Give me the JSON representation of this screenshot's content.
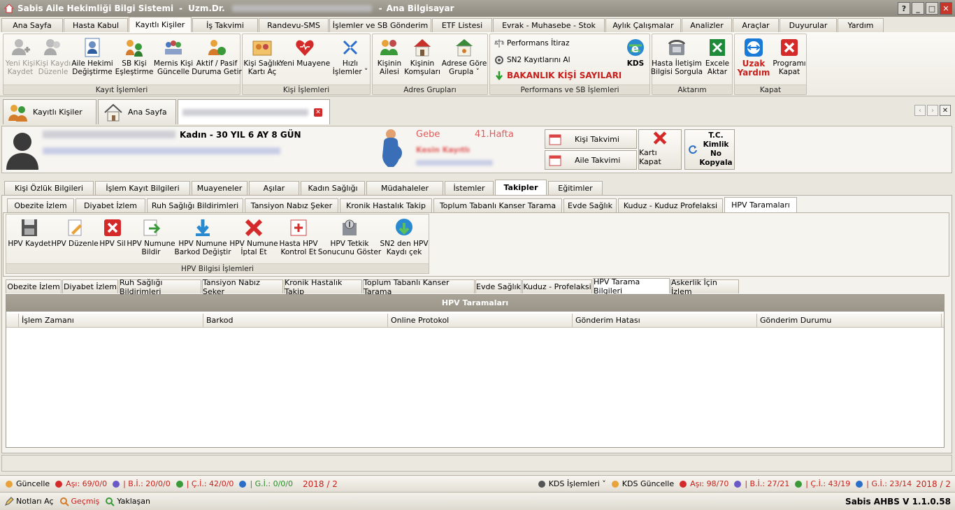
{
  "window": {
    "title": "Sabis Aile Hekimliği Bilgi Sistemi",
    "user_label": "Uzm.Dr.",
    "computer_label": "Ana Bilgisayar",
    "buttons": [
      "?",
      "_",
      "□",
      "✕"
    ]
  },
  "menu_tabs": [
    {
      "label": "Ana Sayfa",
      "w": 88
    },
    {
      "label": "Hasta Kabul",
      "w": 92
    },
    {
      "label": "Kayıtlı Kişiler",
      "w": 90,
      "active": true
    },
    {
      "label": "İş Takvimi",
      "w": 94
    },
    {
      "label": "Randevu-SMS",
      "w": 100
    },
    {
      "label": "İşlemler ve SB Gönderim",
      "w": 146
    },
    {
      "label": "ETF Listesi",
      "w": 86
    },
    {
      "label": "Evrak - Muhasebe - Stok",
      "w": 160
    },
    {
      "label": "Aylık Çalışmalar",
      "w": 108
    },
    {
      "label": "Analizler",
      "w": 72
    },
    {
      "label": "Araçlar",
      "w": 66
    },
    {
      "label": "Duyurular",
      "w": 82
    },
    {
      "label": "Yardım",
      "w": 66
    }
  ],
  "ribbon": {
    "kayit_islemleri": {
      "label": "Kayıt İşlemleri",
      "buttons": [
        "Yeni Kişi\nKaydet",
        "Kişi Kaydı\nDüzenle",
        "Aile Hekimi\nDeğiştirme",
        "SB Kişi\nEşleştirme",
        "Mernis Kişi\nGüncelle",
        "Aktif / Pasif\nDuruma Getir"
      ]
    },
    "kisi_islemleri": {
      "label": "Kişi İşlemleri",
      "buttons": [
        "Kişi Sağlık\nKartı Aç",
        "Yeni Muayene",
        "Hızlı\nİşlemler ˅"
      ]
    },
    "adres_gruplari": {
      "label": "Adres Grupları",
      "buttons": [
        "Kişinin\nAilesi",
        "Kişinin\nKomşuları",
        "Adrese Göre\nGrupla ˅"
      ]
    },
    "performans": {
      "label": "Performans ve SB İşlemleri",
      "items": [
        "Performans İtiraz",
        "SN2 Kayıtlarını Al",
        "BAKANLIK KİŞİ SAYILARI"
      ],
      "kds": "KDS"
    },
    "aktarim": {
      "label": "Aktarım",
      "buttons": [
        "Hasta İletişim\nBilgisi Sorgula",
        "Excele\nAktar"
      ]
    },
    "kapat": {
      "label": "Kapat",
      "buttons": [
        "Uzak\nYardım",
        "Programı\nKapat"
      ]
    }
  },
  "doc_tabs": [
    {
      "label": "Kayıtlı Kişiler"
    },
    {
      "label": "Ana Sayfa"
    },
    {
      "label": ""
    }
  ],
  "patient": {
    "summary": "Kadın - 30 YIL 6 AY 8 GÜN",
    "pregnancy_label": "Gebe",
    "pregnancy_week": "41.Hafta",
    "status": "Kesin Kayıtlı",
    "kisi_takvimi": "Kişi Takvimi",
    "aile_takvimi": "Aile Takvimi",
    "karti_kapat": "Kartı Kapat",
    "tc_kopyala": "T.C.\nKimlik\nNo\nKopyala"
  },
  "main_tabs": [
    {
      "label": "Kişi Özlük Bilgileri",
      "w": 128
    },
    {
      "label": "İşlem Kayıt Bilgileri",
      "w": 136
    },
    {
      "label": "Muayeneler",
      "w": 80
    },
    {
      "label": "Aşılar",
      "w": 72
    },
    {
      "label": "Kadın Sağlığı",
      "w": 92
    },
    {
      "label": "Müdahaleler",
      "w": 110
    },
    {
      "label": "İstemler",
      "w": 70
    },
    {
      "label": "Takipler",
      "w": 74,
      "active": true
    },
    {
      "label": "Eğitimler",
      "w": 78
    }
  ],
  "sub_tabs": [
    {
      "label": "Obezite İzlem",
      "w": 96
    },
    {
      "label": "Diyabet İzlem",
      "w": 100
    },
    {
      "label": "Ruh Sağlığı Bildirimleri",
      "w": 138
    },
    {
      "label": "Tansiyon Nabız Şeker",
      "w": 134
    },
    {
      "label": "Kronik Hastalık Takip",
      "w": 132
    },
    {
      "label": "Toplum Tabanlı Kanser Tarama",
      "w": 184
    },
    {
      "label": "Evde Sağlık",
      "w": 76
    },
    {
      "label": "Kuduz - Kuduz Profelaksi",
      "w": 150
    },
    {
      "label": "HPV Taramaları",
      "w": 104,
      "active": true
    }
  ],
  "hpv_ribbon": {
    "label": "HPV Bilgisi İşlemleri",
    "buttons": [
      "HPV Kaydet",
      "HPV Düzenle",
      "HPV Sil",
      "HPV Numune\nBildir",
      "HPV Numune\nBarkod Değiştir",
      "HPV Numune\nİptal Et",
      "Hasta HPV\nKontrol Et",
      "HPV Tetkik\nSonucunu Göster",
      "SN2 den HPV\nKaydı çek"
    ]
  },
  "lower_tabs": [
    {
      "label": "Obezite İzlem",
      "w": 80
    },
    {
      "label": "Diyabet İzlem",
      "w": 80
    },
    {
      "label": "Ruh Sağlığı Bildirimleri",
      "w": 118
    },
    {
      "label": "Tansiyon Nabız Şeker",
      "w": 116
    },
    {
      "label": "Kronik Hastalık Takip",
      "w": 112
    },
    {
      "label": "Toplum Tabanlı Kanser Tarama",
      "w": 160
    },
    {
      "label": "Evde Sağlık",
      "w": 66
    },
    {
      "label": "Kuduz - Profelaksi",
      "w": 100
    },
    {
      "label": "HPV Tarama Bilgileri",
      "w": 110,
      "active": true
    },
    {
      "label": "Askerlik İçin İzlem",
      "w": 98
    }
  ],
  "table": {
    "title": "HPV Taramaları",
    "columns": [
      {
        "label": "İşlem Zamanı",
        "w": 264
      },
      {
        "label": "Barkod",
        "w": 264
      },
      {
        "label": "Online Protokol",
        "w": 264
      },
      {
        "label": "Gönderim Hatası",
        "w": 264
      },
      {
        "label": "Gönderim Durumu",
        "w": 264
      }
    ]
  },
  "status_left": [
    {
      "label": "Güncelle"
    },
    {
      "label": "Aşı: 69/0/0",
      "red": true
    },
    {
      "label": "| B.İ.: 20/0/0",
      "red": true
    },
    {
      "label": "| Ç.İ.: 42/0/0",
      "red": true
    },
    {
      "label": "| G.İ.: 0/0/0",
      "green": true
    },
    {
      "label": "2018 / 2",
      "red": true
    }
  ],
  "status_right": [
    {
      "label": "KDS İşlemleri ˅"
    },
    {
      "label": "KDS Güncelle"
    },
    {
      "label": "Aşı: 98/70",
      "red": true
    },
    {
      "label": "| B.İ.: 27/21",
      "red": true
    },
    {
      "label": "| Ç.İ.: 43/19",
      "red": true
    },
    {
      "label": "| G.İ.: 23/14",
      "red": true
    },
    {
      "label": "2018 / 2",
      "red": true
    }
  ],
  "bottom": {
    "notlari_ac": "Notları Aç",
    "gecmis": "Geçmiş",
    "yaklasan": "Yaklaşan",
    "version": "Sabis AHBS V 1.1.0.58"
  }
}
